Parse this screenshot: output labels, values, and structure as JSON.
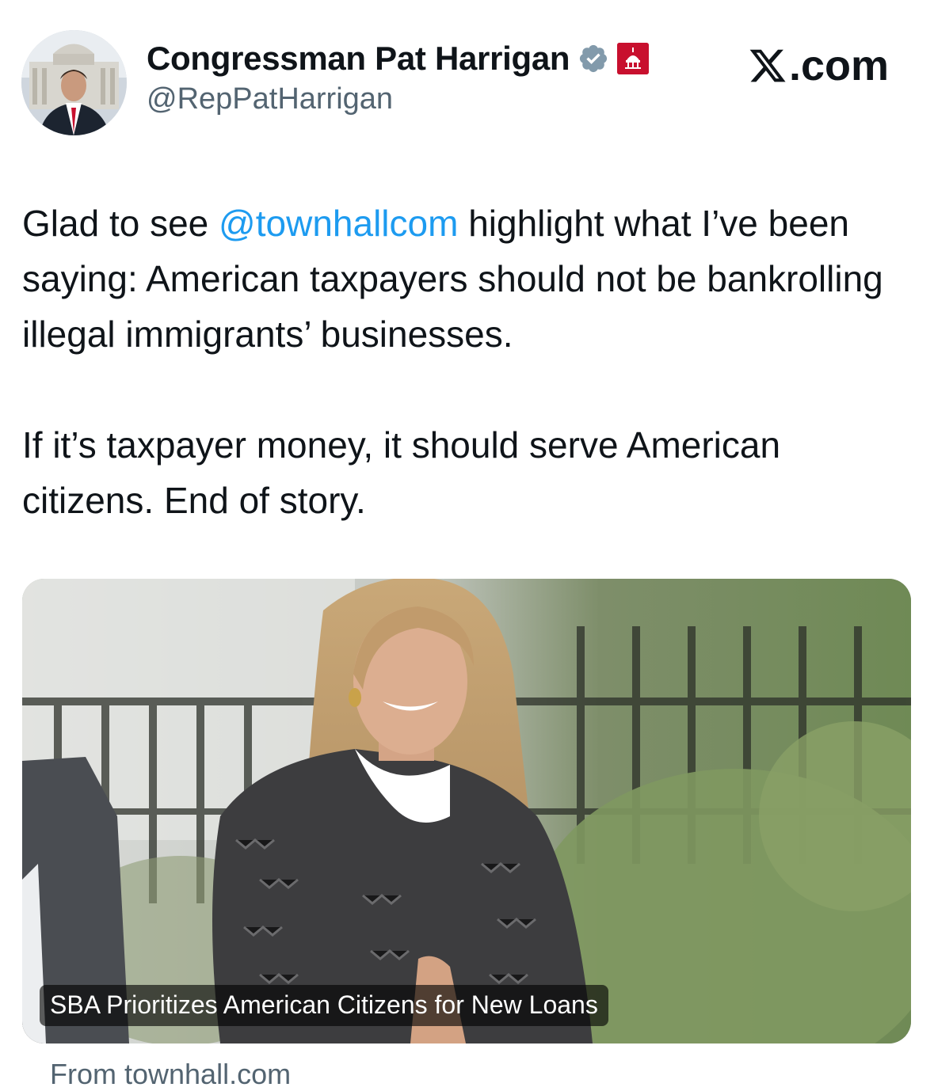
{
  "author": {
    "display_name": "Congressman Pat Harrigan",
    "handle": "@RepPatHarrigan",
    "verified_icon": "verified-badge-icon",
    "affiliation_icon": "government-capitol-badge-icon"
  },
  "brand": {
    "site_label": ".com",
    "logo_icon": "x-logo-icon"
  },
  "tweet": {
    "paragraph1_before": "Glad to see ",
    "mention": "@townhallcom",
    "paragraph1_after": " highlight what I’ve been saying: American taxpayers should not be bankrolling illegal immigrants’ businesses.",
    "paragraph2": "If it’s taxpayer money, it should serve American citizens. End of story."
  },
  "link_card": {
    "title": "SBA Prioritizes American Citizens for New Loans",
    "source": "From townhall.com"
  },
  "colors": {
    "text": "#0f1419",
    "secondary": "#536471",
    "link": "#1d9bf0",
    "badge_red": "#c8102e"
  }
}
